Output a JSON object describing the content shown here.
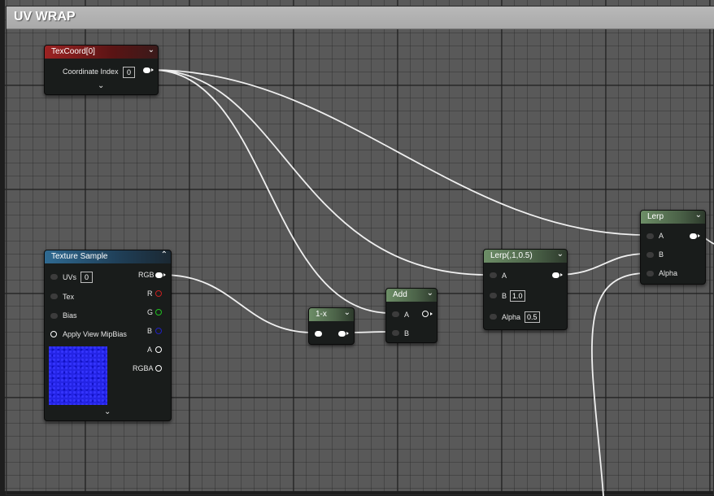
{
  "comment": {
    "title": "UV WRAP"
  },
  "colors": {
    "wire": "#f0f0f0",
    "header_red": "#9c2323",
    "header_blue": "#2f6a92",
    "header_green": "#6d8e67",
    "pin_r": "#c82020",
    "pin_g": "#20c020",
    "pin_b": "#2020c0",
    "preview_blue": "#2424e6"
  },
  "nodes": {
    "texcoord": {
      "title": "TexCoord[0]",
      "property_label": "Coordinate Index",
      "property_value": "0",
      "header_icon": "chevron-down-icon"
    },
    "texture_sample": {
      "title": "Texture Sample",
      "inputs": [
        {
          "label": "UVs",
          "value": "0"
        },
        {
          "label": "Tex"
        },
        {
          "label": "Bias"
        },
        {
          "label": "Apply View MipBias"
        }
      ],
      "outputs": [
        "RGB",
        "R",
        "G",
        "B",
        "A",
        "RGBA"
      ],
      "header_icon": "chevron-up-icon"
    },
    "one_minus": {
      "title": "1-x"
    },
    "add": {
      "title": "Add",
      "inputs": [
        "A",
        "B"
      ]
    },
    "lerp1": {
      "title": "Lerp(,1,0.5)",
      "inputs": [
        {
          "label": "A"
        },
        {
          "label": "B",
          "value": "1.0"
        },
        {
          "label": "Alpha",
          "value": "0.5"
        }
      ]
    },
    "lerp2": {
      "title": "Lerp",
      "inputs": [
        "A",
        "B",
        "Alpha"
      ]
    }
  }
}
